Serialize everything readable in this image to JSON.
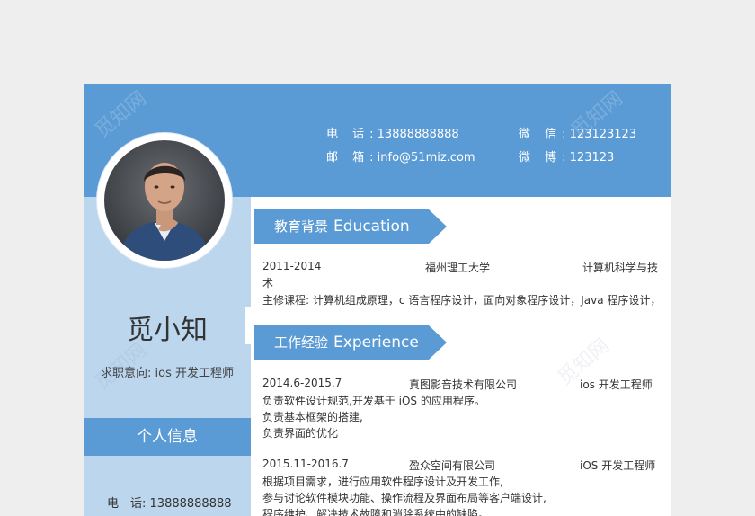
{
  "profile": {
    "name": "觅小知",
    "intent_label": "求职意向",
    "intent_value": "ios 开发工程师"
  },
  "contact": {
    "phone_label": "电 话",
    "phone": "13888888888",
    "email_label": "邮 箱",
    "email": "info@51miz.com",
    "wechat_label": "微 信",
    "wechat": "123123123",
    "weibo_label": "微 博",
    "weibo": "123123"
  },
  "sidebar": {
    "info_title": "个人信息",
    "phone_label": "电　话",
    "phone": "13888888888"
  },
  "education": {
    "title_cn": "教育背景",
    "title_en": "Education",
    "period": "2011-2014",
    "school": "福州理工大学",
    "major_line1": "计算机科学与技",
    "major_line2": "术",
    "courses": "主修课程: 计算机组成原理，c 语言程序设计，面向对象程序设计，Java 程序设计，"
  },
  "experience": {
    "title_cn": "工作经验",
    "title_en": "Experience",
    "jobs": [
      {
        "period": "2014.6-2015.7",
        "company": "真图影音技术有限公司",
        "role": "ios 开发工程师",
        "lines": [
          "负责软件设计规范,开发基于 iOS 的应用程序。",
          "负责基本框架的搭建,",
          "负责界面的优化"
        ]
      },
      {
        "period": "2015.11-2016.7",
        "company": "盈众空间有限公司",
        "role": "iOS 开发工程师",
        "lines": [
          "根据项目需求，进行应用软件程序设计及开发工作,",
          "参与讨论软件模块功能、操作流程及界面布局等客户端设计,",
          "程序维护、解决技术故障和消除系统中的缺陷。"
        ]
      }
    ]
  },
  "watermark": "觅知网",
  "colors": {
    "accent": "#5b9bd5",
    "sidebar": "#bcd6ee",
    "background": "#eeeeee"
  }
}
